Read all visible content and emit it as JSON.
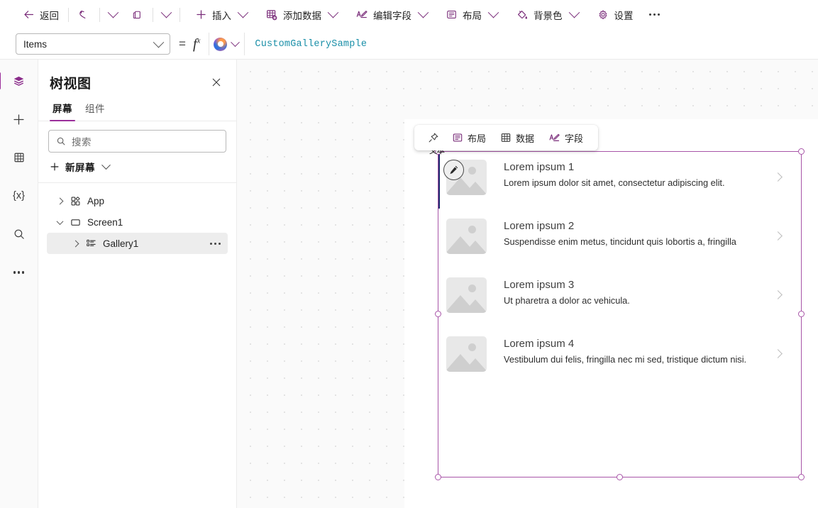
{
  "commandbar": {
    "back": {
      "label": "返回",
      "icon": "arrow-left-icon"
    },
    "undo": {
      "icon": "undo-icon"
    },
    "undo_more": {
      "icon": "chevron-down-icon"
    },
    "paste": {
      "icon": "clipboard-icon"
    },
    "paste_more": {
      "icon": "chevron-down-icon"
    },
    "insert": {
      "label": "插入",
      "icon": "plus-icon"
    },
    "add_data": {
      "label": "添加数据",
      "icon": "table-add-icon"
    },
    "edit_fields": {
      "label": "编辑字段",
      "icon": "edit-fields-icon"
    },
    "layout": {
      "label": "布局",
      "icon": "layout-icon"
    },
    "background": {
      "label": "背景色",
      "icon": "paint-bucket-icon"
    },
    "settings": {
      "label": "设置",
      "icon": "gear-icon"
    },
    "overflow": {
      "label": "...",
      "icon": "more-horizontal-icon"
    }
  },
  "formulabar": {
    "property": "Items",
    "equals": "=",
    "fx": "fx",
    "copilot_icon": "copilot-icon",
    "formula": "CustomGallerySample"
  },
  "rail": {
    "items": [
      {
        "name": "tree-view",
        "icon": "layers-icon",
        "active": true
      },
      {
        "name": "insert",
        "icon": "plus-icon",
        "active": false
      },
      {
        "name": "data",
        "icon": "table-icon",
        "active": false
      },
      {
        "name": "variables",
        "icon": "variables-icon",
        "glyph": "{x}",
        "active": false
      },
      {
        "name": "search",
        "icon": "search-icon",
        "active": false
      },
      {
        "name": "more",
        "icon": "more-horizontal-icon",
        "active": false
      }
    ]
  },
  "treeview": {
    "title": "树视图",
    "close_icon": "close-icon",
    "tabs": [
      {
        "label": "屏幕",
        "active": true
      },
      {
        "label": "组件",
        "active": false
      }
    ],
    "search": {
      "placeholder": "搜索",
      "value": "",
      "icon": "search-icon"
    },
    "new_screen": {
      "label": "新屏幕",
      "icon": "plus-icon"
    },
    "nodes": [
      {
        "label": "App",
        "icon": "app-icon",
        "expanded": false,
        "level": 1,
        "selected": false
      },
      {
        "label": "Screen1",
        "icon": "screen-icon",
        "expanded": true,
        "level": 1,
        "selected": false
      },
      {
        "label": "Gallery1",
        "icon": "gallery-icon",
        "expanded": false,
        "level": 2,
        "selected": true,
        "more": "..."
      }
    ]
  },
  "canvas": {
    "context_toolbar": {
      "pin": {
        "icon": "pin-icon"
      },
      "items": [
        {
          "label": "布局",
          "icon": "layout-panel-icon"
        },
        {
          "label": "数据",
          "icon": "table-icon"
        },
        {
          "label": "字段",
          "icon": "edit-fields-icon"
        }
      ]
    },
    "selection": {
      "label": "文本",
      "edit_badge_icon": "pencil-icon",
      "accent": "#a855a8"
    },
    "gallery": {
      "items": [
        {
          "title": "Lorem ipsum 1",
          "subtitle": "Lorem ipsum dolor sit amet, consectetur adipiscing elit.",
          "thumb_icon": "image-placeholder-icon",
          "chevron": "chevron-right-icon",
          "selected": true
        },
        {
          "title": "Lorem ipsum 2",
          "subtitle": "Suspendisse enim metus, tincidunt quis lobortis a, fringilla",
          "thumb_icon": "image-placeholder-icon",
          "chevron": "chevron-right-icon",
          "selected": false
        },
        {
          "title": "Lorem ipsum 3",
          "subtitle": "Ut pharetra a dolor ac vehicula.",
          "thumb_icon": "image-placeholder-icon",
          "chevron": "chevron-right-icon",
          "selected": false
        },
        {
          "title": "Lorem ipsum 4",
          "subtitle": "Vestibulum dui felis, fringilla nec mi sed, tristique dictum nisi.",
          "thumb_icon": "image-placeholder-icon",
          "chevron": "chevron-right-icon",
          "selected": false
        }
      ]
    }
  }
}
